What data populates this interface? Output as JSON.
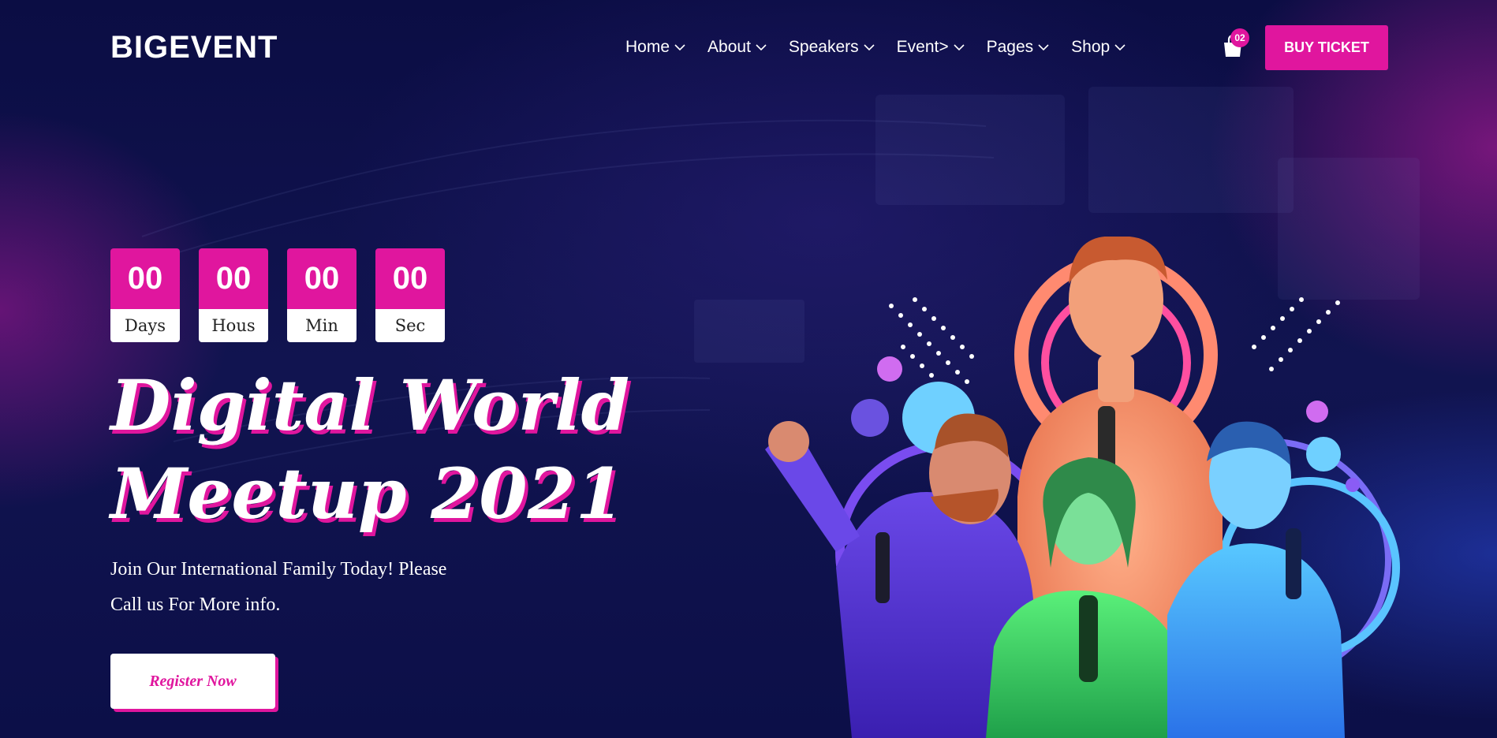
{
  "header": {
    "logo": "BIGEVENT",
    "nav": [
      {
        "label": "Home"
      },
      {
        "label": "About"
      },
      {
        "label": "Speakers"
      },
      {
        "label": "Event>"
      },
      {
        "label": "Pages"
      },
      {
        "label": "Shop"
      }
    ],
    "cart_count": "02",
    "buy_label": "BUY TICKET"
  },
  "countdown": [
    {
      "value": "00",
      "label": "Days"
    },
    {
      "value": "00",
      "label": "Hous"
    },
    {
      "value": "00",
      "label": "Min"
    },
    {
      "value": "00",
      "label": "Sec"
    }
  ],
  "hero": {
    "title_line1": "Digital World",
    "title_line2": "Meetup 2021",
    "subtitle_line1": "Join Our International Family Today! Please",
    "subtitle_line2": "Call us For More info.",
    "register_label": "Register Now"
  },
  "colors": {
    "accent": "#e0169e",
    "background": "#0d0f4a"
  },
  "icons": {
    "cart": "shopping-bag-icon",
    "dropdown": "chevron-down-icon"
  }
}
